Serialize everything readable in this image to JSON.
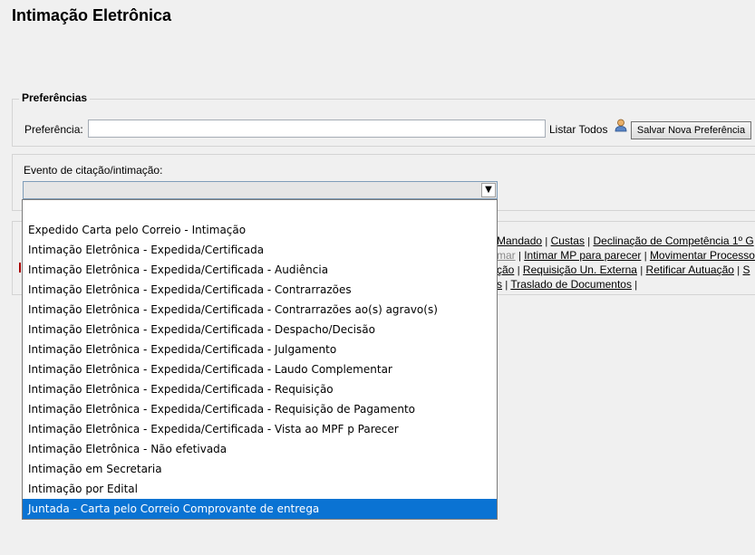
{
  "page": {
    "title": "Intimação Eletrônica"
  },
  "preferences": {
    "legend": "Preferências",
    "label": "Preferência:",
    "input_value": "",
    "list_all": "Listar Todos",
    "save_button": "Salvar Nova Preferência",
    "icon": "user-icon"
  },
  "event": {
    "label": "Evento de citação/intimação:",
    "selected_value": "",
    "options": [
      "",
      "Expedido Carta pelo Correio - Intimação",
      "Intimação Eletrônica - Expedida/Certificada",
      "Intimação Eletrônica - Expedida/Certificada - Audiência",
      "Intimação Eletrônica - Expedida/Certificada - Contrarrazões",
      "Intimação Eletrônica - Expedida/Certificada - Contrarrazões ao(s) agravo(s)",
      "Intimação Eletrônica - Expedida/Certificada - Despacho/Decisão",
      "Intimação Eletrônica - Expedida/Certificada - Julgamento",
      "Intimação Eletrônica - Expedida/Certificada - Laudo Complementar",
      "Intimação Eletrônica - Expedida/Certificada - Requisição",
      "Intimação Eletrônica - Expedida/Certificada - Requisição de Pagamento",
      "Intimação Eletrônica - Expedida/Certificada - Vista ao MPF p Parecer",
      "Intimação Eletrônica - Não efetivada",
      "Intimação em Secretaria",
      "Intimação por Edital",
      "Juntada - Carta pelo Correio Comprovante de entrega"
    ],
    "highlighted_index": 15,
    "highlight_color": "#0a73d3"
  },
  "actions": {
    "row1": [
      "Mandado",
      "Custas",
      "Declinação de Competência 1º G"
    ],
    "row2_disabled": "mar",
    "row2": [
      "Intimar MP para parecer",
      "Movimentar Processo"
    ],
    "row3": [
      "ção",
      "Requisição Un. Externa",
      "Retificar Autuação",
      "S"
    ],
    "row4": [
      "s",
      "Traslado de Documentos"
    ],
    "separator": "|"
  }
}
